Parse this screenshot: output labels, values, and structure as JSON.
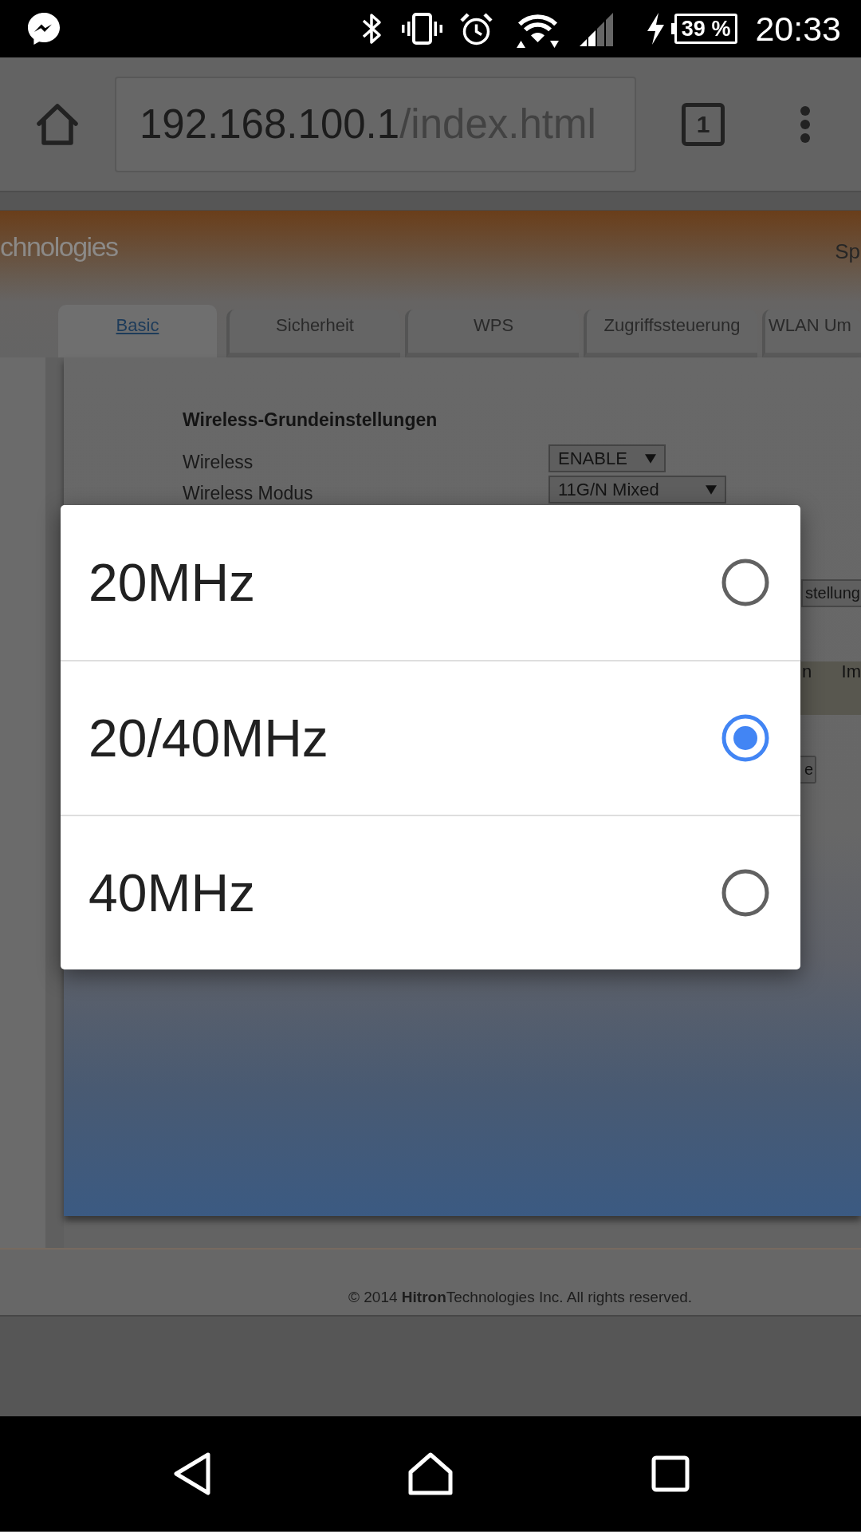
{
  "status_bar": {
    "battery": "39 %",
    "time": "20:33"
  },
  "browser": {
    "url_host": "192.168.100.1",
    "url_path": "/index.html",
    "tab_count": "1"
  },
  "page": {
    "logo_text": "chnologies",
    "header_link": "Sp",
    "tabs": [
      {
        "label": "Basic",
        "selected": true
      },
      {
        "label": "Sicherheit",
        "selected": false
      },
      {
        "label": "WPS",
        "selected": false
      },
      {
        "label": "Zugriffssteuerung",
        "selected": false
      },
      {
        "label": "WLAN Um",
        "selected": false
      }
    ],
    "section_title": "Wireless-Grundeinstellungen",
    "fields": [
      {
        "label": "Wireless",
        "value": "ENABLE"
      },
      {
        "label": "Wireless Modus",
        "value": "11G/N Mixed"
      }
    ],
    "select_3": "stellung",
    "table_columns": [
      "n",
      "Im"
    ],
    "button_1": "e",
    "footer": "© 2014 **Hitron**Technologies Inc.  All rights reserved."
  },
  "dialog": {
    "options": [
      {
        "label": "20MHz",
        "selected": false
      },
      {
        "label": "20/40MHz",
        "selected": true
      },
      {
        "label": "40MHz",
        "selected": false
      }
    ]
  }
}
